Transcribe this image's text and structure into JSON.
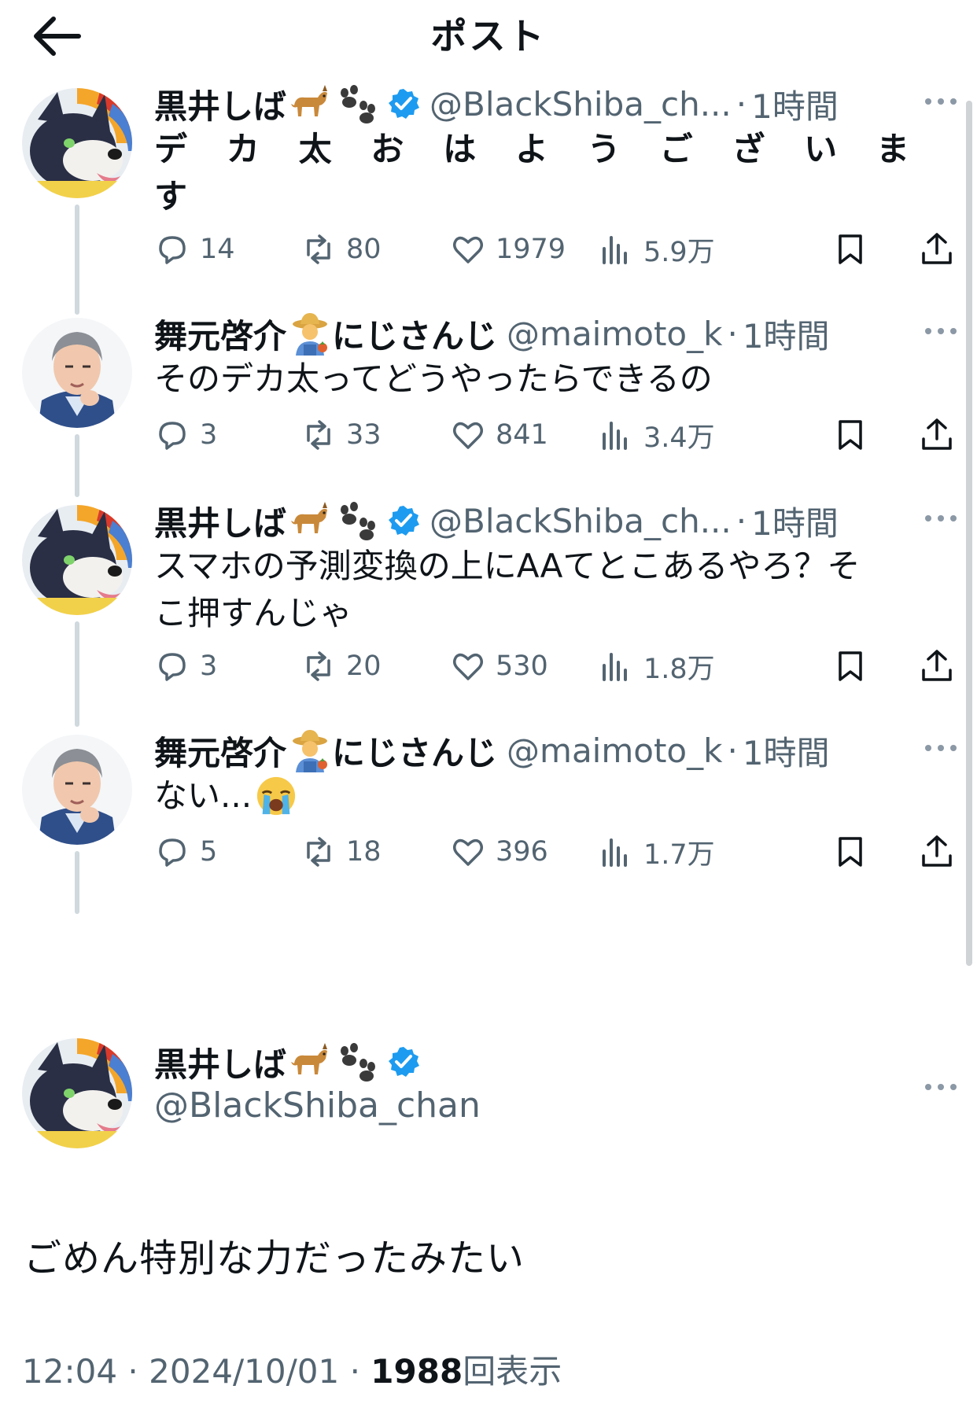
{
  "header": {
    "title": "ポスト",
    "back_icon": "arrow-left-icon"
  },
  "colors": {
    "verified": "#1d9bf0",
    "muted": "#536471",
    "text": "#0f1419",
    "thread": "#cfd9de"
  },
  "tweets": [
    {
      "name": "黒井しば",
      "verified": true,
      "handle": "@BlackShiba_ch...",
      "time": "1時間",
      "text": "デカ太おはようございます",
      "text_chars": [
        "デ",
        "カ",
        "太",
        "お",
        "は",
        "よ",
        "う",
        "ご",
        "ざ",
        "い",
        "ま",
        "す"
      ],
      "reply": "14",
      "retweet": "80",
      "like": "1979",
      "views": "5.9万"
    },
    {
      "name": "舞元啓介",
      "suffix": "にじさんじ",
      "verified": false,
      "handle": "@maimoto_k",
      "time": "1時間",
      "text": "そのデカ太ってどうやったらできるの",
      "reply": "3",
      "retweet": "33",
      "like": "841",
      "views": "3.4万"
    },
    {
      "name": "黒井しば",
      "verified": true,
      "handle": "@BlackShiba_ch...",
      "time": "1時間",
      "text_line1": "スマホの予測変換の上にAAてとこあるやろ？そ",
      "text_line2": "こ押すんじゃ",
      "reply": "3",
      "retweet": "20",
      "like": "530",
      "views": "1.8万"
    },
    {
      "name": "舞元啓介",
      "suffix": "にじさんじ",
      "verified": false,
      "handle": "@maimoto_k",
      "time": "1時間",
      "text": "ない...",
      "reply": "5",
      "retweet": "18",
      "like": "396",
      "views": "1.7万"
    }
  ],
  "main_post": {
    "name": "黒井しば",
    "handle": "@BlackShiba_chan",
    "text": "ごめん特別な力だったみたい",
    "time": "12:04",
    "date": "2024/10/01",
    "views_count": "1988",
    "views_label": "回表示"
  },
  "separator": "·"
}
